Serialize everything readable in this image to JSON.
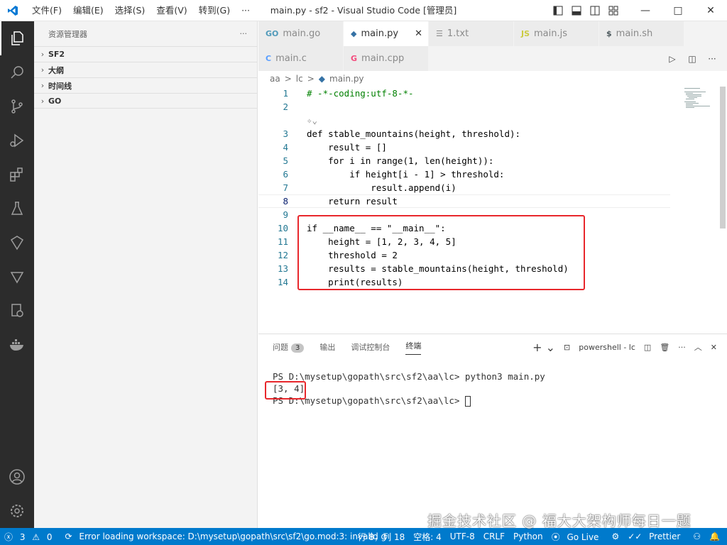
{
  "titlebar": {
    "menu": [
      "文件(F)",
      "编辑(E)",
      "选择(S)",
      "查看(V)",
      "转到(G)",
      "···"
    ],
    "title": "main.py - sf2 - Visual Studio Code [管理员]"
  },
  "sidebar": {
    "header": "资源管理器",
    "more": "···",
    "sections": [
      "SF2",
      "大纲",
      "时间线",
      "GO"
    ]
  },
  "tabs_row1": [
    {
      "label": "main.go",
      "icon": "GO",
      "color": "#519aba"
    },
    {
      "label": "main.py",
      "icon": "py",
      "color": "#3572a5",
      "active": true
    },
    {
      "label": "1.txt",
      "icon": "txt",
      "color": "#888888"
    },
    {
      "label": "main.js",
      "icon": "JS",
      "color": "#cbcb41"
    },
    {
      "label": "main.sh",
      "icon": "$",
      "color": "#4d5a5e"
    }
  ],
  "tabs_row2": [
    {
      "label": "main.c",
      "icon": "C",
      "color": "#599eff"
    },
    {
      "label": "main.cpp",
      "icon": "G",
      "color": "#f34b7d"
    }
  ],
  "breadcrumb": [
    "aa",
    ">",
    "lc",
    ">",
    "main.py"
  ],
  "code": {
    "lines": [
      {
        "n": "1",
        "text": "# -*-coding:utf-8-*-"
      },
      {
        "n": "2",
        "text": ""
      },
      {
        "n": "3",
        "text": "def stable_mountains(height, threshold):"
      },
      {
        "n": "4",
        "text": "    result = []"
      },
      {
        "n": "5",
        "text": "    for i in range(1, len(height)):"
      },
      {
        "n": "6",
        "text": "        if height[i - 1] > threshold:"
      },
      {
        "n": "7",
        "text": "            result.append(i)"
      },
      {
        "n": "8",
        "text": "    return result"
      },
      {
        "n": "9",
        "text": ""
      },
      {
        "n": "10",
        "text": "if __name__ == \"__main__\":"
      },
      {
        "n": "11",
        "text": "    height = [1, 2, 3, 4, 5]"
      },
      {
        "n": "12",
        "text": "    threshold = 2"
      },
      {
        "n": "13",
        "text": "    results = stable_mountains(height, threshold)"
      },
      {
        "n": "14",
        "text": "    print(results)"
      }
    ]
  },
  "panel": {
    "tabs": [
      "问题",
      "输出",
      "调试控制台",
      "终端"
    ],
    "problems_count": "3",
    "terminal_name": "powershell - lc",
    "terminal_lines": [
      "PS D:\\mysetup\\gopath\\src\\sf2\\aa\\lc> python3 main.py",
      "[3, 4]",
      "PS D:\\mysetup\\gopath\\src\\sf2\\aa\\lc> "
    ]
  },
  "statusbar": {
    "errors": "3",
    "warnings": "0",
    "message": "Error loading workspace: D:\\mysetup\\gopath\\src\\sf2\\go.mod:3: invalid g",
    "position": "行 8，列 18",
    "spaces": "空格: 4",
    "encoding": "UTF-8",
    "eol": "CRLF",
    "language": "Python",
    "golive": "Go Live",
    "prettier": "Prettier"
  },
  "watermark": "掘金技术社区 @ 福大大架构师每日一题",
  "colors": {
    "accent": "#007acc",
    "highlight_box": "#e8272c",
    "activity_bar": "#2c2c2c"
  }
}
